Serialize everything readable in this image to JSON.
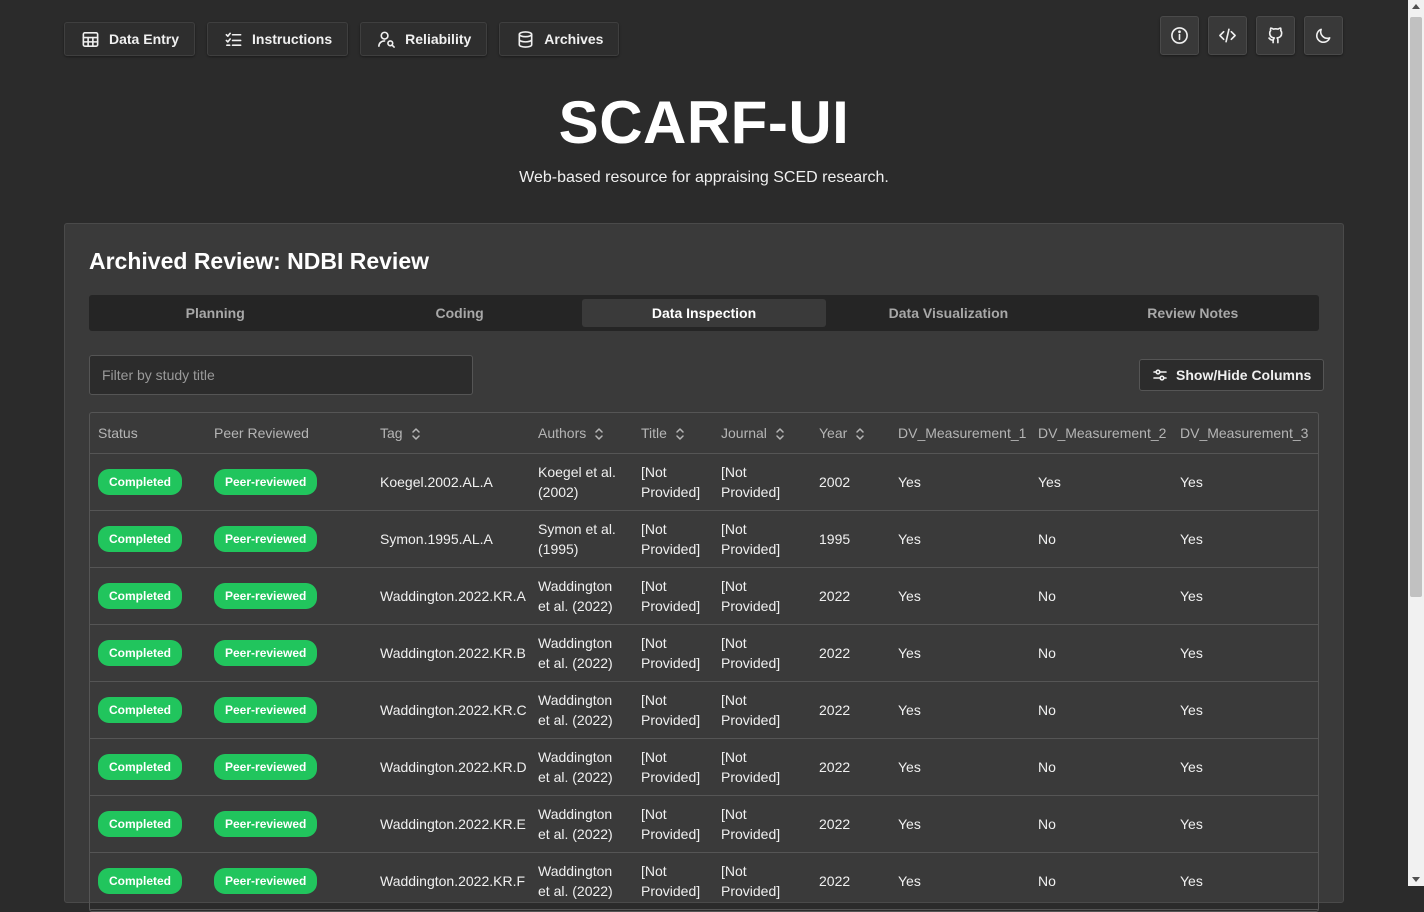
{
  "nav": {
    "data_entry": "Data Entry",
    "instructions": "Instructions",
    "reliability": "Reliability",
    "archives": "Archives"
  },
  "toolbar_icons": [
    "info-icon",
    "code-icon",
    "github-icon",
    "moon-icon"
  ],
  "header": {
    "title": "SCARF-UI",
    "subtitle": "Web-based resource for appraising SCED research."
  },
  "review": {
    "title": "Archived Review: NDBI Review",
    "tabs": [
      "Planning",
      "Coding",
      "Data Inspection",
      "Data Visualization",
      "Review Notes"
    ],
    "active_tab": "Data Inspection",
    "filter_placeholder": "Filter by study title",
    "show_hide_label": "Show/Hide Columns"
  },
  "table": {
    "columns": [
      "Status",
      "Peer Reviewed",
      "Tag",
      "Authors",
      "Title",
      "Journal",
      "Year",
      "DV_Measurement_1",
      "DV_Measurement_2",
      "DV_Measurement_3"
    ],
    "sortable": [
      false,
      false,
      true,
      true,
      true,
      true,
      true,
      false,
      false,
      false
    ],
    "rows": [
      {
        "status": "Completed",
        "peer": "Peer-reviewed",
        "tag": "Koegel.2002.AL.A",
        "authors_1": "Koegel et al.",
        "authors_2": "(2002)",
        "title_1": "[Not",
        "title_2": "Provided]",
        "journal_1": "[Not",
        "journal_2": "Provided]",
        "year": "2002",
        "dv1": "Yes",
        "dv2": "Yes",
        "dv3": "Yes"
      },
      {
        "status": "Completed",
        "peer": "Peer-reviewed",
        "tag": "Symon.1995.AL.A",
        "authors_1": "Symon et al.",
        "authors_2": "(1995)",
        "title_1": "[Not",
        "title_2": "Provided]",
        "journal_1": "[Not",
        "journal_2": "Provided]",
        "year": "1995",
        "dv1": "Yes",
        "dv2": "No",
        "dv3": "Yes"
      },
      {
        "status": "Completed",
        "peer": "Peer-reviewed",
        "tag": "Waddington.2022.KR.A",
        "authors_1": "Waddington",
        "authors_2": "et al. (2022)",
        "title_1": "[Not",
        "title_2": "Provided]",
        "journal_1": "[Not",
        "journal_2": "Provided]",
        "year": "2022",
        "dv1": "Yes",
        "dv2": "No",
        "dv3": "Yes"
      },
      {
        "status": "Completed",
        "peer": "Peer-reviewed",
        "tag": "Waddington.2022.KR.B",
        "authors_1": "Waddington",
        "authors_2": "et al. (2022)",
        "title_1": "[Not",
        "title_2": "Provided]",
        "journal_1": "[Not",
        "journal_2": "Provided]",
        "year": "2022",
        "dv1": "Yes",
        "dv2": "No",
        "dv3": "Yes"
      },
      {
        "status": "Completed",
        "peer": "Peer-reviewed",
        "tag": "Waddington.2022.KR.C",
        "authors_1": "Waddington",
        "authors_2": "et al. (2022)",
        "title_1": "[Not",
        "title_2": "Provided]",
        "journal_1": "[Not",
        "journal_2": "Provided]",
        "year": "2022",
        "dv1": "Yes",
        "dv2": "No",
        "dv3": "Yes"
      },
      {
        "status": "Completed",
        "peer": "Peer-reviewed",
        "tag": "Waddington.2022.KR.D",
        "authors_1": "Waddington",
        "authors_2": "et al. (2022)",
        "title_1": "[Not",
        "title_2": "Provided]",
        "journal_1": "[Not",
        "journal_2": "Provided]",
        "year": "2022",
        "dv1": "Yes",
        "dv2": "No",
        "dv3": "Yes"
      },
      {
        "status": "Completed",
        "peer": "Peer-reviewed",
        "tag": "Waddington.2022.KR.E",
        "authors_1": "Waddington",
        "authors_2": "et al. (2022)",
        "title_1": "[Not",
        "title_2": "Provided]",
        "journal_1": "[Not",
        "journal_2": "Provided]",
        "year": "2022",
        "dv1": "Yes",
        "dv2": "No",
        "dv3": "Yes"
      },
      {
        "status": "Completed",
        "peer": "Peer-reviewed",
        "tag": "Waddington.2022.KR.F",
        "authors_1": "Waddington",
        "authors_2": "et al. (2022)",
        "title_1": "[Not",
        "title_2": "Provided]",
        "journal_1": "[Not",
        "journal_2": "Provided]",
        "year": "2022",
        "dv1": "Yes",
        "dv2": "No",
        "dv3": "Yes"
      }
    ]
  },
  "colors": {
    "background": "#2b2b2b",
    "card": "#3a3a3a",
    "badge_green": "#21c55d"
  }
}
